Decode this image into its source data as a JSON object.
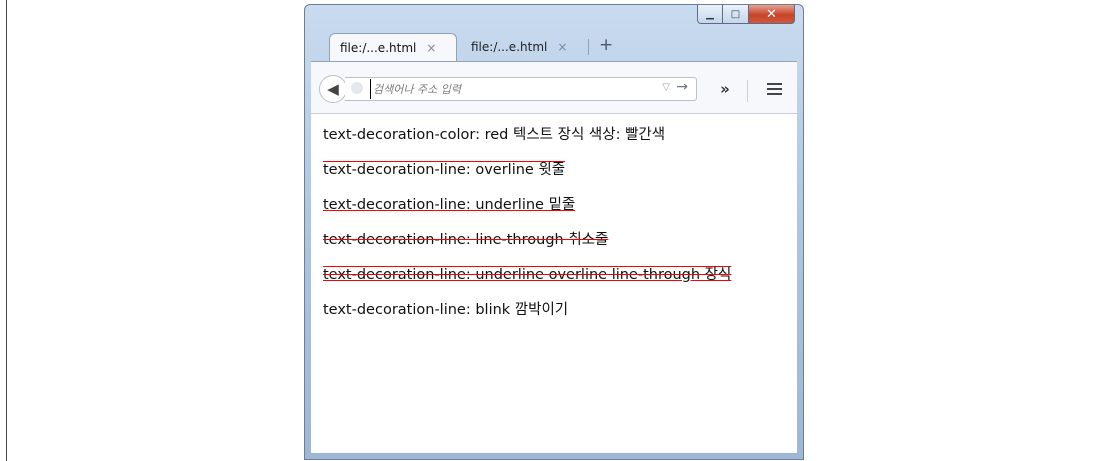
{
  "browser": {
    "tabs": [
      {
        "label": "file:/...e.html",
        "active": true
      },
      {
        "label": "file:/...e.html",
        "active": false
      }
    ],
    "tab_close_glyph": "×",
    "new_tab_glyph": "+",
    "url_placeholder": "검색어나 주소 입력",
    "overflow_glyph": "»",
    "icons": [
      "minimize-icon",
      "maximize-icon",
      "close-icon",
      "back-arrow-icon",
      "site-identity-icon",
      "dropdown-icon",
      "go-arrow-icon",
      "overflow-chevron-icon",
      "hamburger-menu-icon"
    ]
  },
  "page": {
    "lines": [
      "text-decoration-color: red 텍스트 장식 색상: 빨간색",
      "text-decoration-line: overline 윗줄",
      "text-decoration-line: underline 밑줄",
      "text-decoration-line: line-through 취소줄",
      "text-decoration-line: underline overline line-through 장식",
      "text-decoration-line: blink 깜박이기"
    ]
  },
  "colors": {
    "decoration": "#ff0000",
    "close_button": "#c7452a"
  }
}
